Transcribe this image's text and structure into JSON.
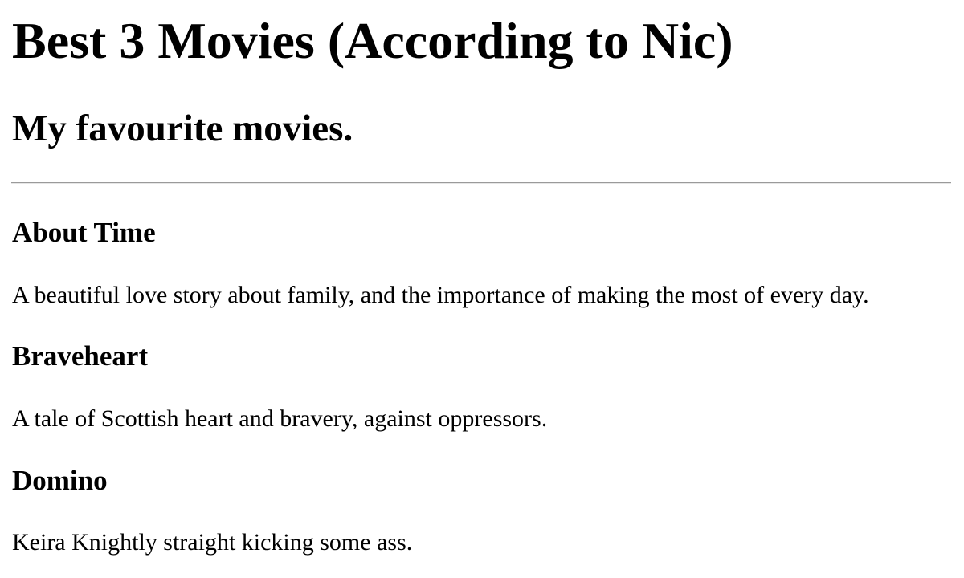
{
  "header": {
    "title": "Best 3 Movies (According to Nic)",
    "subtitle": "My favourite movies."
  },
  "movies": [
    {
      "title": "About Time",
      "description": "A beautiful love story about family, and the importance of making the most of every day."
    },
    {
      "title": "Braveheart",
      "description": "A tale of Scottish heart and bravery, against oppressors."
    },
    {
      "title": "Domino",
      "description": "Keira Knightly straight kicking some ass."
    }
  ]
}
